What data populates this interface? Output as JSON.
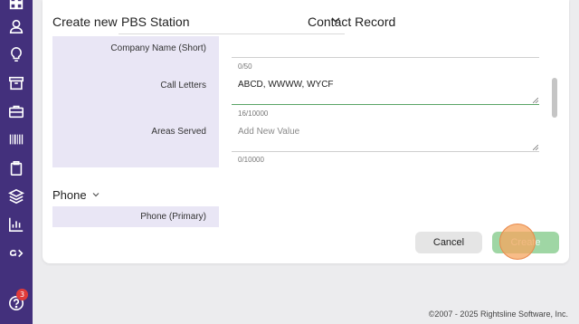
{
  "sidebar": {
    "icons": [
      "grid-icon",
      "person-icon",
      "lightbulb-icon",
      "archive-icon",
      "briefcase-icon",
      "barcode-icon",
      "clipboard-icon",
      "layers-icon",
      "bar-chart-icon",
      "amazon-icon",
      "help-icon"
    ],
    "help_badge": "3",
    "color": "#43307c"
  },
  "header": {
    "create_new": "Create new",
    "type_value": "PBS Station",
    "record_label": "Contact Record"
  },
  "fields": {
    "company_short": {
      "label": "Company Name (Short)",
      "counter": "0/50"
    },
    "call_letters": {
      "label": "Call Letters",
      "value": "ABCD, WWWW, WYCF",
      "counter": "16/10000"
    },
    "areas_served": {
      "label": "Areas Served",
      "placeholder": "Add New Value",
      "counter": "0/10000"
    }
  },
  "phone_section": {
    "title": "Phone",
    "phone_primary": {
      "label": "Phone (Primary)"
    }
  },
  "actions": {
    "cancel": "Cancel",
    "create": "Create"
  },
  "footer": {
    "copyright": "©2007 - 2025 Rightsline Software, Inc."
  },
  "colors": {
    "accent": "#43307c",
    "label_bg": "#e9e6f5",
    "active_underline": "#5aa466",
    "create_button": "#9fd6a4"
  }
}
